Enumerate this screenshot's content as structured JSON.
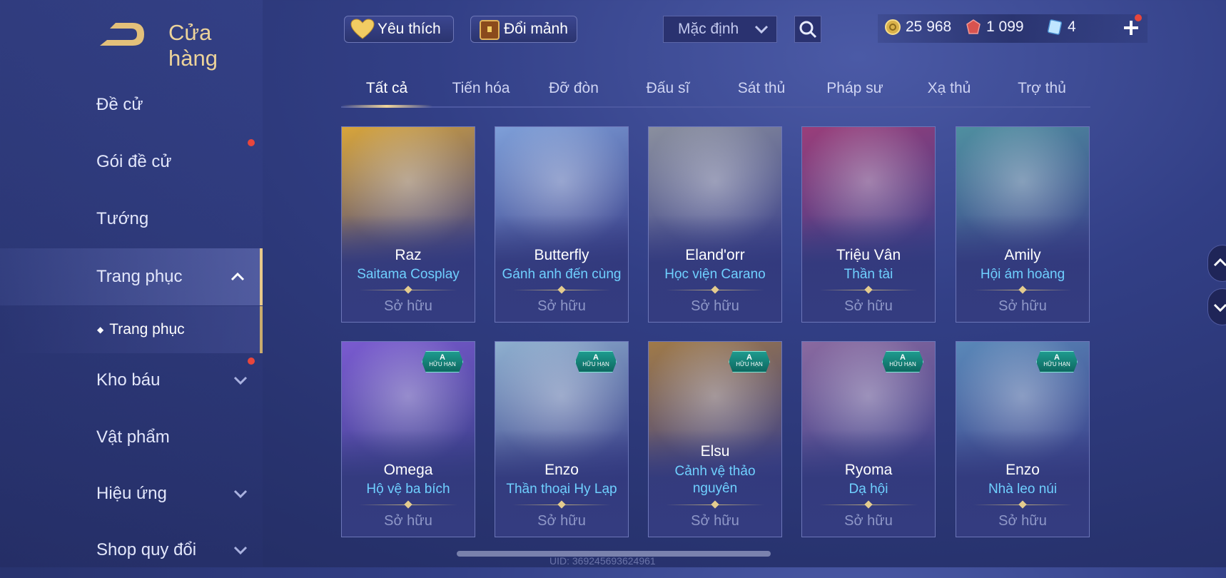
{
  "header": {
    "title": "Cửa hàng",
    "favorites_label": "Yêu thích",
    "exchange_label": "Đổi mảnh",
    "sort_value": "Mặc định"
  },
  "currencies": {
    "gold": "25 968",
    "vouchers": "1 099",
    "tickets": "4"
  },
  "sidebar": {
    "items": [
      {
        "label": "Đề cử"
      },
      {
        "label": "Gói đề cử"
      },
      {
        "label": "Tướng"
      },
      {
        "label": "Trang phục"
      },
      {
        "label": "Kho báu"
      },
      {
        "label": "Vật phẩm"
      },
      {
        "label": "Hiệu ứng"
      },
      {
        "label": "Shop quy đổi"
      }
    ],
    "sub_item": "Trang phục"
  },
  "tabs": [
    "Tất cả",
    "Tiến hóa",
    "Đỡ đòn",
    "Đấu sĩ",
    "Sát thủ",
    "Pháp sư",
    "Xạ thủ",
    "Trợ thủ"
  ],
  "badge": {
    "rank": "A",
    "text": "HỮU HẠN"
  },
  "cards": [
    {
      "hero": "Raz",
      "skin": "Saitama Cosplay",
      "status": "Sở hữu",
      "color": "#d8a53a"
    },
    {
      "hero": "Butterfly",
      "skin": "Gánh anh đến cùng",
      "status": "Sở hữu",
      "color": "#7e9fd8"
    },
    {
      "hero": "Eland'orr",
      "skin": "Học viện Carano",
      "status": "Sở hữu",
      "color": "#8a8f9e"
    },
    {
      "hero": "Triệu Vân",
      "skin": "Thần tài",
      "status": "Sở hữu",
      "color": "#9a3e7a"
    },
    {
      "hero": "Amily",
      "skin": "Hội ám hoàng",
      "status": "Sở hữu",
      "color": "#4f8fa0"
    },
    {
      "hero": "Omega",
      "skin": "Hộ vệ ba bích",
      "status": "Sở hữu",
      "color": "#7a5bd0"
    },
    {
      "hero": "Enzo",
      "skin": "Thần thoại Hy Lạp",
      "status": "Sở hữu",
      "color": "#8fb0cf"
    },
    {
      "hero": "Elsu",
      "skin": "Cảnh vệ thảo nguyên",
      "status": "Sở hữu",
      "color": "#a07a48"
    },
    {
      "hero": "Ryoma",
      "skin": "Dạ hội",
      "status": "Sở hữu",
      "color": "#8a6aa0"
    },
    {
      "hero": "Enzo",
      "skin": "Nhà leo núi",
      "status": "Sở hữu",
      "color": "#5a88b8"
    }
  ],
  "footer": {
    "uid": "UID: 369245693624961"
  }
}
